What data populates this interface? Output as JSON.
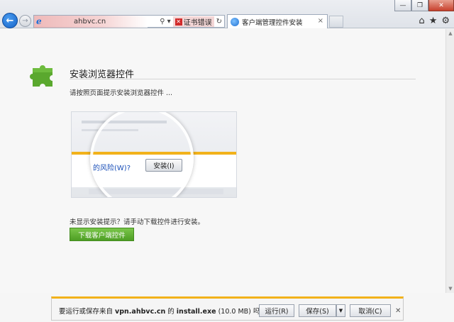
{
  "browser": {
    "address": "ahbvc.cn",
    "cert_error": "证书错误",
    "tab_title": "客户端管理控件安装",
    "tab_close": "×",
    "search_glyph": "⚲",
    "refresh_glyph": "↻",
    "home_glyph": "⌂",
    "favorites_glyph": "★",
    "tools_glyph": "⚙",
    "icons": [
      "back-arrow-icon",
      "forward-arrow-icon",
      "ie-icon",
      "search-icon",
      "refresh-icon",
      "home-icon",
      "star-icon",
      "gear-icon"
    ]
  },
  "page": {
    "title": "安装浏览器控件",
    "instruction": "请按照页面提示安装浏览器控件 ...",
    "demo_risk_text": "的风险(W)?",
    "demo_install_label": "安装(I)",
    "no_prompt_text": "未显示安装提示？请手动下载控件进行安装。",
    "download_button": "下载客户端控件"
  },
  "notification": {
    "message_prefix": "要运行或保存来自",
    "domain": "vpn.ahbvc.cn",
    "message_mid": "的",
    "filename": "install.exe",
    "size": "(10.0 MB)",
    "message_suffix": "吗?",
    "run_label": "运行(R)",
    "save_label": "保存(S)",
    "cancel_label": "取消(C)"
  },
  "colors": {
    "accent_green": "#5aa82e",
    "notify_yellow": "#f2b21b",
    "ie_blue": "#1563c8"
  }
}
